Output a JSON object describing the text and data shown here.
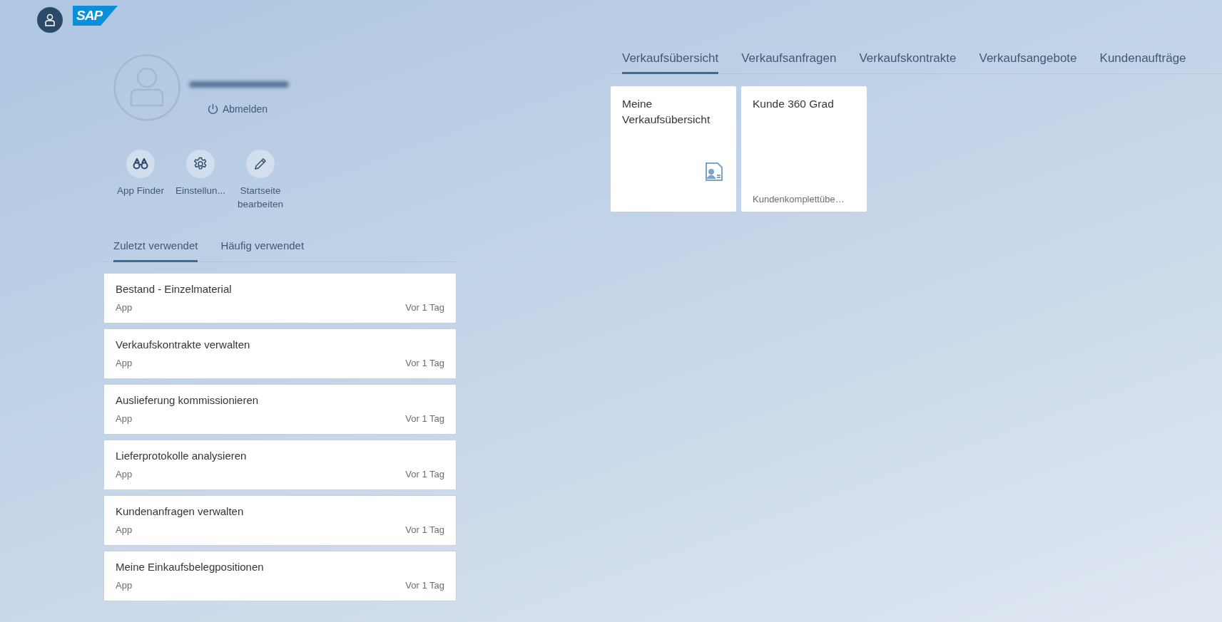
{
  "header": {
    "logo_text": "SAP"
  },
  "profile": {
    "logout_label": "Abmelden"
  },
  "actions": [
    {
      "kind": "finder",
      "label": "App Finder"
    },
    {
      "kind": "settings",
      "label": "Einstellun..."
    },
    {
      "kind": "edit",
      "label": "Startseite bearbeiten"
    }
  ],
  "recent_tabs": [
    {
      "label": "Zuletzt verwendet",
      "selected": true
    },
    {
      "label": "Häufig verwendet",
      "selected": false
    }
  ],
  "recent_items": [
    {
      "title": "Bestand - Einzelmaterial",
      "type": "App",
      "time": "Vor 1 Tag"
    },
    {
      "title": "Verkaufskontrakte verwalten",
      "type": "App",
      "time": "Vor 1 Tag"
    },
    {
      "title": "Auslieferung kommissionieren",
      "type": "App",
      "time": "Vor 1 Tag"
    },
    {
      "title": "Lieferprotokolle analysieren",
      "type": "App",
      "time": "Vor 1 Tag"
    },
    {
      "title": "Kundenanfragen verwalten",
      "type": "App",
      "time": "Vor 1 Tag"
    },
    {
      "title": "Meine Einkaufsbelegpositionen",
      "type": "App",
      "time": "Vor 1 Tag"
    }
  ],
  "group_tabs": [
    {
      "label": "Verkaufsübersicht",
      "selected": true
    },
    {
      "label": "Verkaufsanfragen",
      "selected": false
    },
    {
      "label": "Verkaufskontrakte",
      "selected": false
    },
    {
      "label": "Verkaufsangebote",
      "selected": false
    },
    {
      "label": "Kundenaufträge",
      "selected": false
    }
  ],
  "tiles": [
    {
      "kind": "icon",
      "title": "Meine Verkaufsübersicht"
    },
    {
      "kind": "footer",
      "title": "Kunde 360 Grad",
      "footer": "Kundenkomplettübe…"
    }
  ]
}
